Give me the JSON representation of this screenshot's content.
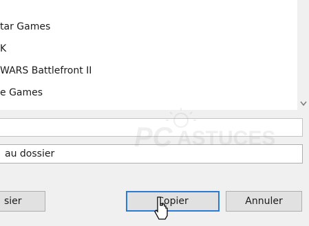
{
  "folder_list": {
    "items": [
      {
        "label": "tar Games"
      },
      {
        "label": "K"
      },
      {
        "label": "WARS Battlefront II"
      },
      {
        "label": "e Games"
      }
    ]
  },
  "name_field": {
    "value": "au dossier"
  },
  "buttons": {
    "new_folder": "sier",
    "copy": "Copier",
    "cancel": "Annuler"
  },
  "watermark": {
    "text": "PC ASTUCES"
  },
  "colors": {
    "accent": "#2a7ad5",
    "list_bg": "#ffffff",
    "window_bg": "#f0f0f0"
  }
}
